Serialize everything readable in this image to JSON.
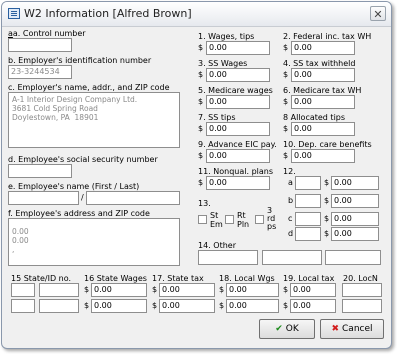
{
  "window": {
    "title": "W2 Information [Alfred Brown]",
    "close_glyph": "✕"
  },
  "left": {
    "control_number": {
      "label": "a. Control number",
      "value": ""
    },
    "employer_id": {
      "label": "b. Employer's identification number",
      "value": "23-3244534"
    },
    "employer_name": {
      "label": "c. Employer's name, addr., and ZIP code",
      "value": "A-1 Interior Design Company Ltd.\n3681 Cold Spring Road\nDoylestown, PA  18901"
    },
    "employee_ssn": {
      "label": "d. Employee's social security number",
      "value": ""
    },
    "employee_name": {
      "label": "e. Employee's name (First / Last)",
      "first": "",
      "slash": "/",
      "last": ""
    },
    "employee_address": {
      "label": "f. Employee's address and ZIP code",
      "value": "0.00\n0.00\n,"
    }
  },
  "boxes": {
    "b1": {
      "label": "1. Wages, tips",
      "value": "0.00"
    },
    "b2": {
      "label": "2. Federal inc. tax WH",
      "value": "0.00"
    },
    "b3": {
      "label": "3. SS Wages",
      "value": "0.00"
    },
    "b4": {
      "label": "4. SS tax withheld",
      "value": "0.00"
    },
    "b5": {
      "label": "5. Medicare wages",
      "value": "0.00"
    },
    "b6": {
      "label": "6. Medicare tax WH",
      "value": "0.00"
    },
    "b7": {
      "label": "7. SS tips",
      "value": "0.00"
    },
    "b8": {
      "label": "8 Allocated tips",
      "value": "0.00"
    },
    "b9": {
      "label": "9. Advance EIC pay.",
      "value": "0.00"
    },
    "b10": {
      "label": "10. Dep. care benefits",
      "value": "0.00"
    },
    "b11": {
      "label": "11. Nonqual. plans",
      "value": "0.00"
    },
    "b12": {
      "label": "12.",
      "rows": [
        {
          "letter": "a",
          "code": "",
          "value": "0.00"
        },
        {
          "letter": "b",
          "code": "",
          "value": "0.00"
        },
        {
          "letter": "c",
          "code": "",
          "value": "0.00"
        },
        {
          "letter": "d",
          "code": "",
          "value": "0.00"
        }
      ]
    },
    "b13": {
      "label": "13.",
      "checks": [
        {
          "line1": "St",
          "line2": "Em",
          "checked": false
        },
        {
          "line1": "Rt",
          "line2": "Pln",
          "checked": false
        },
        {
          "line1": "3",
          "line2": "rd",
          "line3": "ps",
          "checked": false
        }
      ]
    },
    "b14": {
      "label": "14. Other"
    }
  },
  "bottom": {
    "b15": {
      "label": "15 State/ID no."
    },
    "b16": {
      "label": "16 State Wages",
      "values": [
        "0.00",
        "0.00"
      ]
    },
    "b17": {
      "label": "17. State tax",
      "values": [
        "0.00",
        "0.00"
      ]
    },
    "b18": {
      "label": "18. Local Wgs",
      "values": [
        "0.00",
        "0.00"
      ]
    },
    "b19": {
      "label": "19. Local tax",
      "values": [
        "0.00",
        "0.00"
      ]
    },
    "b20": {
      "label": "20. LocN"
    }
  },
  "currency": "$",
  "buttons": {
    "ok": "OK",
    "ok_icon": "✔",
    "cancel": "Cancel",
    "cancel_icon": "✖"
  }
}
